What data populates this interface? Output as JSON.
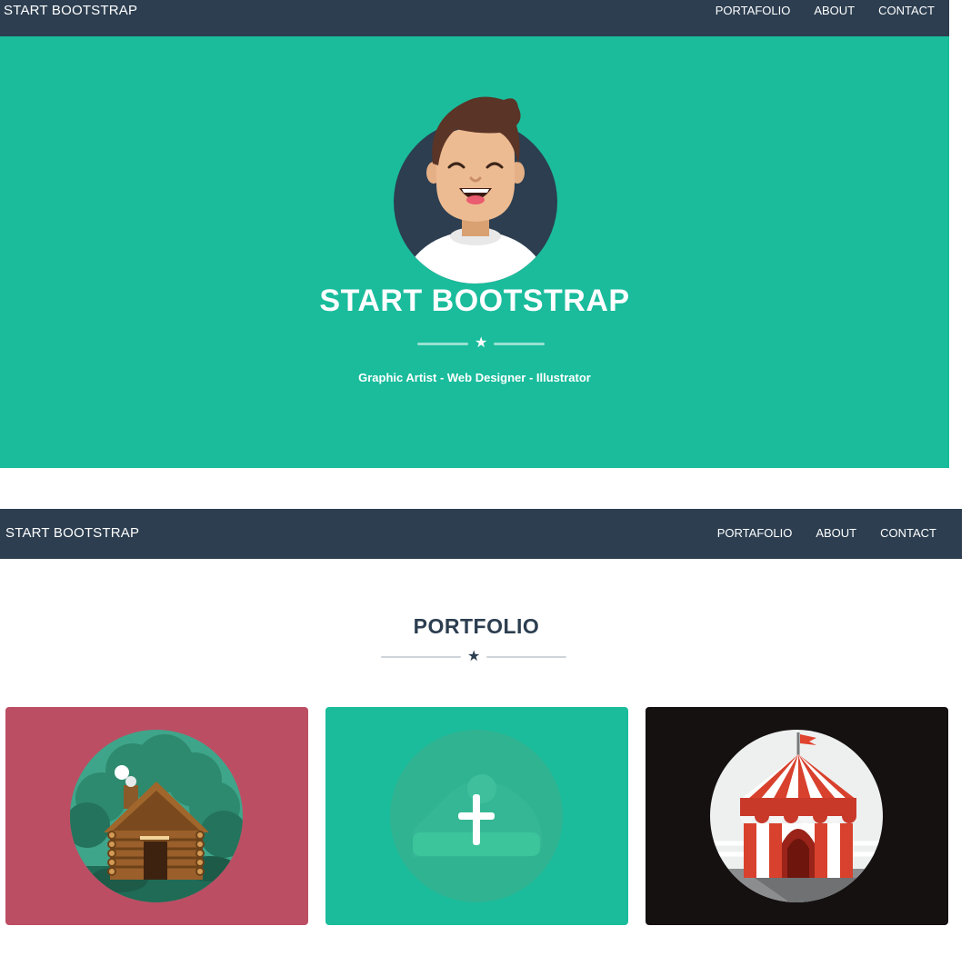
{
  "navbar_top": {
    "brand": "START BOOTSTRAP",
    "links": [
      "PORTAFOLIO",
      "ABOUT",
      "CONTACT"
    ]
  },
  "hero": {
    "title": "START BOOTSTRAP",
    "subtitle": "Graphic Artist - Web Designer - Illustrator",
    "divider_icon": "star-icon"
  },
  "navbar_bottom": {
    "brand": "START BOOTSTRAP",
    "links": [
      "PORTAFOLIO",
      "ABOUT",
      "CONTACT"
    ]
  },
  "portfolio": {
    "title": "PORTFOLIO",
    "divider_icon": "star-icon",
    "items": [
      {
        "icon": "log-cabin-icon",
        "background": "#bc4e64"
      },
      {
        "icon": "plus-icon",
        "background": "#1abc9c"
      },
      {
        "icon": "circus-tent-icon",
        "background": "#161111"
      }
    ]
  },
  "colors": {
    "navbar": "#2c3e50",
    "accent": "#1abc9c",
    "text_light": "#ffffff",
    "text_dark": "#2c3e50"
  }
}
